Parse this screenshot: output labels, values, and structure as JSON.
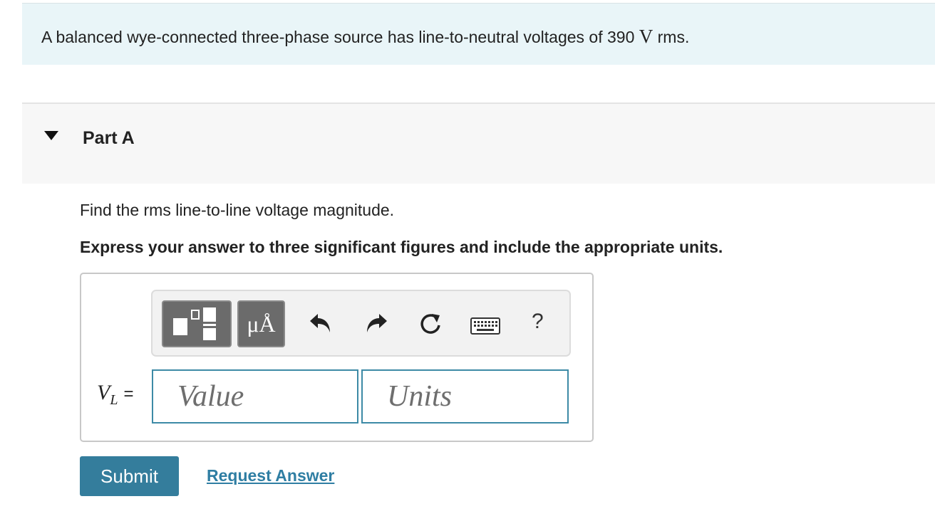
{
  "problem": {
    "text_before": "A balanced wye-connected three-phase source has line-to-neutral voltages of 390 ",
    "unit": "V",
    "text_after": " rms."
  },
  "part": {
    "title": "Part A",
    "question": "Find the rms line-to-line voltage magnitude.",
    "instruction": "Express your answer to three significant figures and include the appropriate units."
  },
  "toolbar": {
    "units_label": "μÅ",
    "help_label": "?",
    "icons": [
      "templates-icon",
      "units-icon",
      "undo-icon",
      "redo-icon",
      "reset-icon",
      "keyboard-icon",
      "help-icon"
    ]
  },
  "answer": {
    "variable": "V",
    "subscript": "L",
    "equals": "=",
    "value_placeholder": "Value",
    "units_placeholder": "Units"
  },
  "actions": {
    "submit_label": "Submit",
    "request_label": "Request Answer"
  },
  "colors": {
    "problem_bg": "#e9f5f8",
    "accent": "#347d9c",
    "field_border": "#3d8aa6"
  }
}
